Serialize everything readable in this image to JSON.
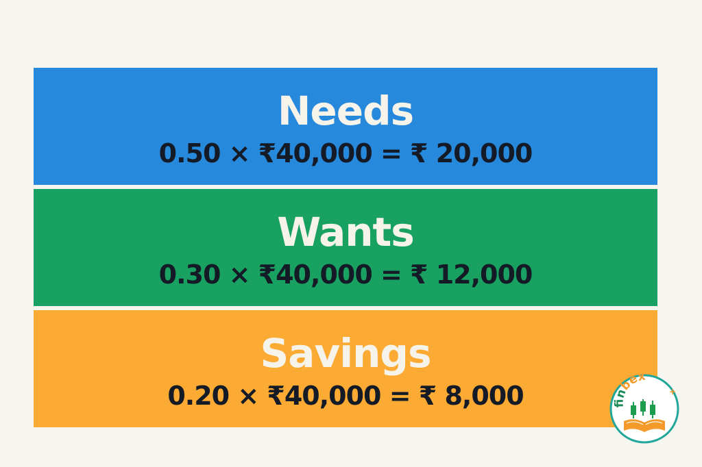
{
  "rows": [
    {
      "title": "Needs",
      "formula": "0.50 × ₹40,000 = ₹ 20,000",
      "color": "#2789dc"
    },
    {
      "title": "Wants",
      "formula": "0.30 × ₹40,000 = ₹ 12,000",
      "color": "#18a160"
    },
    {
      "title": "Savings",
      "formula": "0.20 × ₹40,000 = ₹ 8,000",
      "color": "#fbab33"
    }
  ],
  "logo": {
    "text_part1": "fin",
    "text_part2": "bex",
    "text_suffix": "+",
    "icons": [
      "candlestick-chart-icon",
      "open-book-icon"
    ],
    "colors": {
      "ring": "#21a79a",
      "text_green": "#1c8a57",
      "text_orange": "#f39a2b",
      "book": "#f39a2b",
      "candles": "#1b9c4f"
    }
  }
}
